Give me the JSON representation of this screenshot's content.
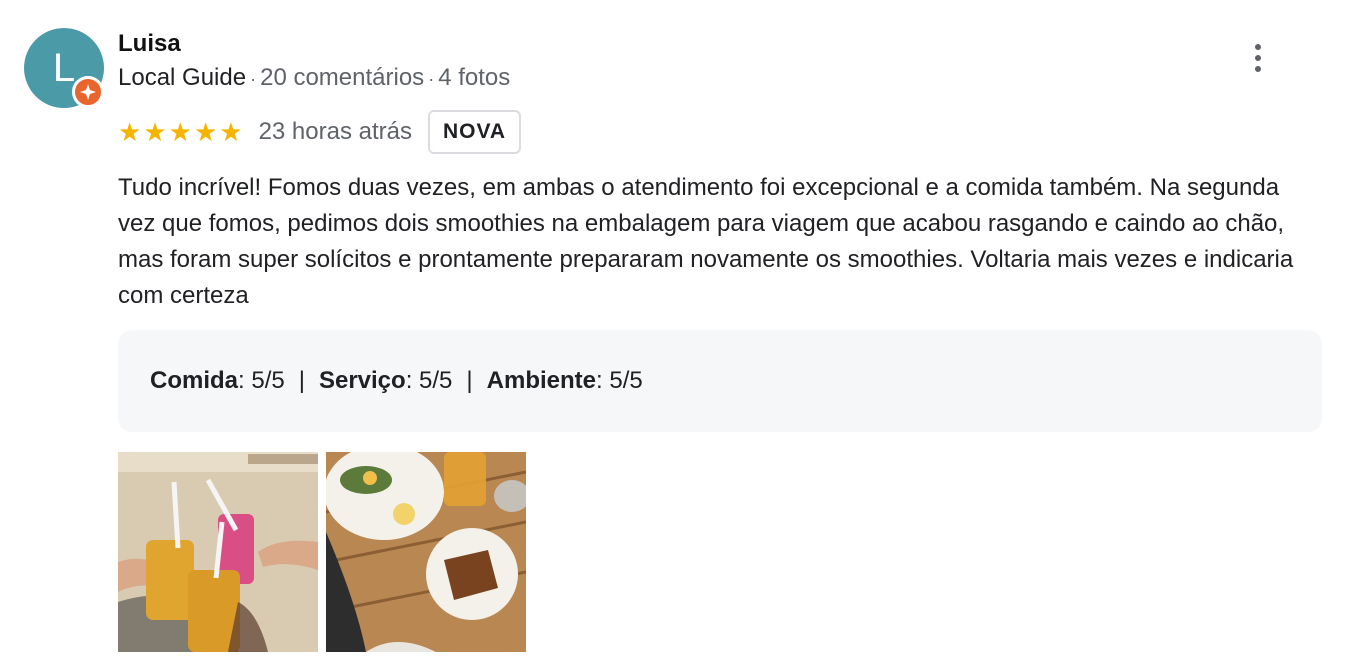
{
  "author": {
    "initial": "L",
    "name": "Luisa",
    "badge": "Local Guide",
    "reviews": "20 comentários",
    "photos": "4 fotos",
    "avatar_color": "#4a9aa8",
    "badge_color": "#e8662d"
  },
  "review": {
    "rating": 5,
    "stars": "★★★★★",
    "time_ago": "23 horas atrás",
    "new_label": "NOVA",
    "text": "Tudo incrível! Fomos duas vezes, em ambas o atendimento foi excepcional e a comida também. Na segunda vez que fomos, pedimos dois smoothies na embalagem para viagem que acabou rasgando e caindo ao chão, mas foram super solícitos e prontamente prepararam novamente os smoothies. Voltaria mais vezes e indicaria com certeza"
  },
  "ratings": {
    "food_label": "Comida",
    "food_value": "5/5",
    "service_label": "Serviço",
    "service_value": "5/5",
    "ambience_label": "Ambiente",
    "ambience_value": "5/5"
  },
  "menu": {
    "icon": "more-vert-icon"
  },
  "photos": [
    {
      "subject": "smoothies-on-beach"
    },
    {
      "subject": "brunch-plates-on-table"
    }
  ],
  "colors": {
    "star": "#f4b400",
    "meta_text": "#5f6368",
    "ratings_bg": "#f6f7f9"
  }
}
